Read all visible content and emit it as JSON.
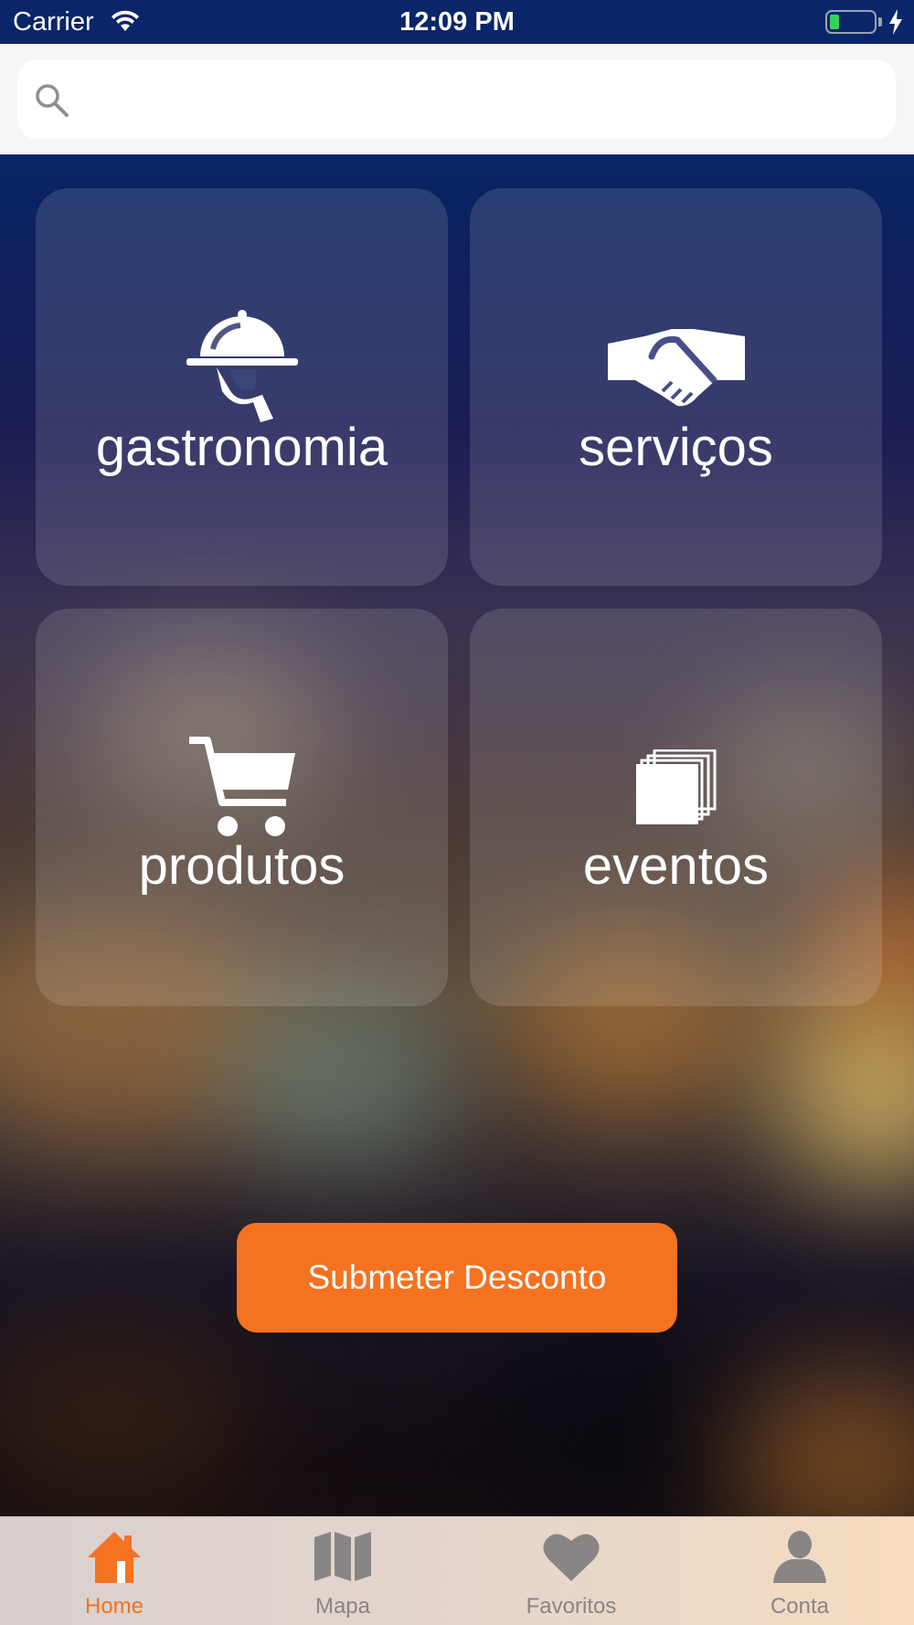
{
  "status_bar": {
    "carrier": "Carrier",
    "time": "12:09 PM"
  },
  "search": {
    "placeholder": "",
    "value": ""
  },
  "categories": [
    {
      "label": "gastronomia",
      "icon": "cloche-waiter-icon"
    },
    {
      "label": "serviços",
      "icon": "handshake-icon"
    },
    {
      "label": "produtos",
      "icon": "shopping-cart-icon"
    },
    {
      "label": "eventos",
      "icon": "stacked-cards-icon"
    }
  ],
  "submit_button": {
    "label": "Submeter Desconto"
  },
  "tab_bar": {
    "items": [
      {
        "label": "Home",
        "icon": "home-icon",
        "active": true
      },
      {
        "label": "Mapa",
        "icon": "map-icon",
        "active": false
      },
      {
        "label": "Favoritos",
        "icon": "heart-icon",
        "active": false
      },
      {
        "label": "Conta",
        "icon": "user-icon",
        "active": false
      }
    ]
  },
  "colors": {
    "accent": "#f47220",
    "status_bar": "#0a2569",
    "tab_inactive": "#8a8585"
  }
}
